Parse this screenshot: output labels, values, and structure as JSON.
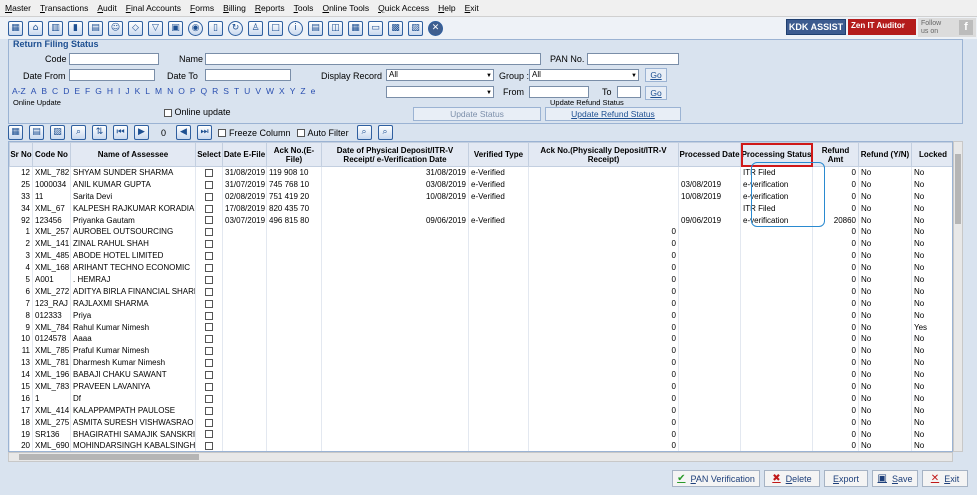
{
  "menu": [
    "Master",
    "Transactions",
    "Audit",
    "Final Accounts",
    "Forms",
    "Billing",
    "Reports",
    "Tools",
    "Online Tools",
    "Quick Access",
    "Help",
    "Exit"
  ],
  "brand": {
    "kdk": "KDK ASSIST",
    "zen": "Zen IT Auditor",
    "follow": "Follow us on",
    "fb": "f"
  },
  "panel_title": "Return Filing Status",
  "filters": {
    "code": "Code",
    "name": "Name",
    "pan": "PAN No.",
    "date_from": "Date From",
    "date_to": "Date To",
    "display_record": "Display Record",
    "display_record_value": "All",
    "group": "Group :",
    "group_value": "All",
    "go": "Go",
    "from": "From",
    "to": "To",
    "online_update": "Online Update",
    "online_update_chk": "Online update",
    "update_refund_status": "Update Refund Status",
    "update_status_btn": "Update Status",
    "update_refund_btn": "Update Refund Status"
  },
  "alphabet": [
    "A-Z",
    "A",
    "B",
    "C",
    "D",
    "E",
    "F",
    "G",
    "H",
    "I",
    "J",
    "K",
    "L",
    "M",
    "N",
    "O",
    "P",
    "Q",
    "R",
    "S",
    "T",
    "U",
    "V",
    "W",
    "X",
    "Y",
    "Z",
    "e"
  ],
  "gridtoolbar": {
    "count": "0",
    "freeze": "Freeze Column",
    "autofilter": "Auto Filter"
  },
  "columns": [
    "Sr No",
    "Code No",
    "Name of Assessee",
    "Select",
    "Date E-File",
    "Ack No.(E-File)",
    "Date of Physical Deposit/ITR-V Receipt/ e-Verification Date",
    "Verified Type",
    "Ack No.(Physically Deposit/ITR-V Receipt)",
    "Processed Date",
    "Processing Status",
    "Refund Amt",
    "Refund (Y/N)",
    "Locked"
  ],
  "rows": [
    [
      "12",
      "XML_782",
      "SHYAM SUNDER SHARMA",
      "31/08/2019",
      "119 908 10",
      "31/08/2019",
      "e-Verified",
      "",
      "",
      "ITR Filed",
      "0",
      "No",
      "No"
    ],
    [
      "25",
      "1000034",
      "ANIL KUMAR GUPTA",
      "31/07/2019",
      "745 768 10",
      "03/08/2019",
      "e-Verified",
      "",
      "03/08/2019",
      "e-verification",
      "0",
      "No",
      "No"
    ],
    [
      "33",
      "11",
      "Sarita Devi",
      "02/08/2019",
      "751 419 20",
      "10/08/2019",
      "e-Verified",
      "",
      "10/08/2019",
      "e-verification",
      "0",
      "No",
      "No"
    ],
    [
      "34",
      "XML_67",
      "KALPESH RAJKUMAR KORADIA",
      "17/08/2019",
      "820 435 70",
      "",
      "",
      "",
      "",
      "ITR Filed",
      "0",
      "No",
      "No"
    ],
    [
      "92",
      "123456",
      "Priyanka Gautam",
      "03/07/2019",
      "496 815 80",
      "09/06/2019",
      "e-Verified",
      "",
      "09/06/2019",
      "e-verification",
      "20860",
      "No",
      "No"
    ],
    [
      "1",
      "XML_257",
      "AUROBEL OUTSOURCING",
      "",
      "",
      "",
      "",
      "0",
      "",
      "",
      "0",
      "No",
      "No"
    ],
    [
      "2",
      "XML_141",
      "ZINAL RAHUL SHAH",
      "",
      "",
      "",
      "",
      "0",
      "",
      "",
      "0",
      "No",
      "No"
    ],
    [
      "3",
      "XML_485",
      "ABODE HOTEL LIMITED",
      "",
      "",
      "",
      "",
      "0",
      "",
      "",
      "0",
      "No",
      "No"
    ],
    [
      "4",
      "XML_168",
      "ARIHANT TECHNO ECONOMIC",
      "",
      "",
      "",
      "",
      "0",
      "",
      "",
      "0",
      "No",
      "No"
    ],
    [
      "5",
      "A001",
      ". HEMRAJ",
      "",
      "",
      "",
      "",
      "0",
      "",
      "",
      "0",
      "No",
      "No"
    ],
    [
      "6",
      "XML_272",
      "ADITYA BIRLA FINANCIAL SHARED",
      "",
      "",
      "",
      "",
      "0",
      "",
      "",
      "0",
      "No",
      "No"
    ],
    [
      "7",
      "123_RAJ",
      "RAJLAXMI SHARMA",
      "",
      "",
      "",
      "",
      "0",
      "",
      "",
      "0",
      "No",
      "No"
    ],
    [
      "8",
      "012333",
      "Priya",
      "",
      "",
      "",
      "",
      "0",
      "",
      "",
      "0",
      "No",
      "No"
    ],
    [
      "9",
      "XML_784",
      "Rahul Kumar Nimesh",
      "",
      "",
      "",
      "",
      "0",
      "",
      "",
      "0",
      "No",
      "Yes"
    ],
    [
      "10",
      "0124578",
      "Aaaa",
      "",
      "",
      "",
      "",
      "0",
      "",
      "",
      "0",
      "No",
      "No"
    ],
    [
      "11",
      "XML_785",
      "Praful Kumar Nimesh",
      "",
      "",
      "",
      "",
      "0",
      "",
      "",
      "0",
      "No",
      "No"
    ],
    [
      "13",
      "XML_781",
      "Dharmesh Kumar Nimesh",
      "",
      "",
      "",
      "",
      "0",
      "",
      "",
      "0",
      "No",
      "No"
    ],
    [
      "14",
      "XML_196",
      "BABAJI CHAKU SAWANT",
      "",
      "",
      "",
      "",
      "0",
      "",
      "",
      "0",
      "No",
      "No"
    ],
    [
      "15",
      "XML_783",
      "PRAVEEN LAVANIYA",
      "",
      "",
      "",
      "",
      "0",
      "",
      "",
      "0",
      "No",
      "No"
    ],
    [
      "16",
      "1",
      "Df",
      "",
      "",
      "",
      "",
      "0",
      "",
      "",
      "0",
      "No",
      "No"
    ],
    [
      "17",
      "XML_414",
      "KALAPPAMPATH PAULOSE",
      "",
      "",
      "",
      "",
      "0",
      "",
      "",
      "0",
      "No",
      "No"
    ],
    [
      "18",
      "XML_275",
      "ASMITA SURESH VISHWASRAO",
      "",
      "",
      "",
      "",
      "0",
      "",
      "",
      "0",
      "No",
      "No"
    ],
    [
      "19",
      "SR136",
      "BHAGIRATHI SAMAJIK SANSKRITI",
      "",
      "",
      "",
      "",
      "0",
      "",
      "",
      "0",
      "No",
      "No"
    ],
    [
      "20",
      "XML_690",
      "MOHINDARSINGH KABALSINGH",
      "",
      "",
      "",
      "",
      "0",
      "",
      "",
      "0",
      "No",
      "No"
    ]
  ],
  "buttons": {
    "pan": "PAN Verification",
    "delete": "Delete",
    "export": "Export",
    "save": "Save",
    "exit": "Exit"
  }
}
